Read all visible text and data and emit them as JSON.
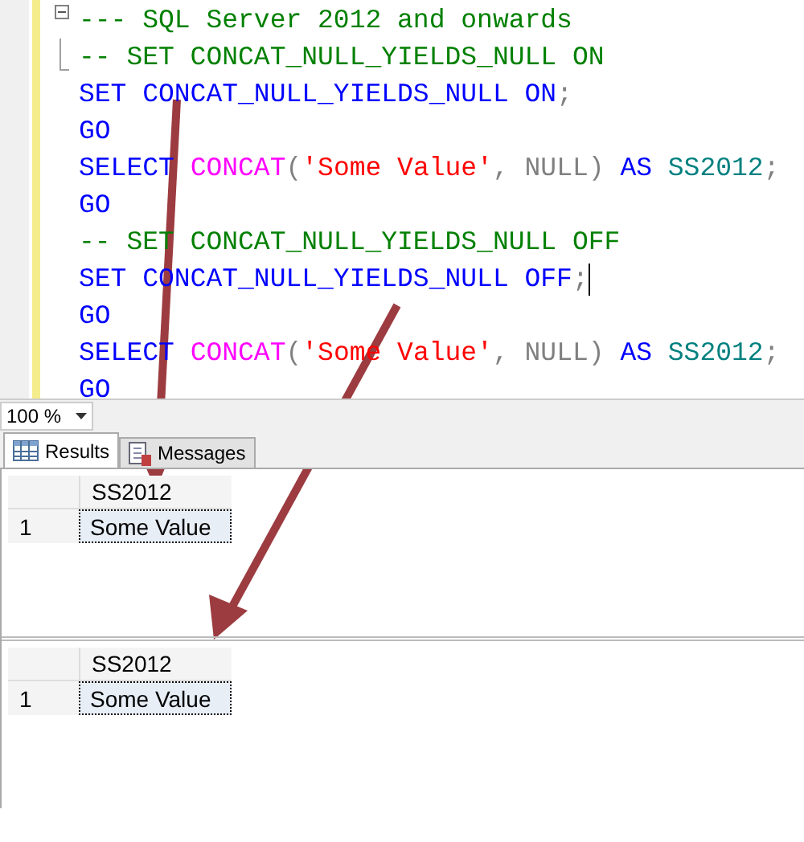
{
  "editor": {
    "lines": [
      {
        "tokens": [
          {
            "kind": "comment",
            "text": "--- SQL Server 2012 and onwards"
          }
        ]
      },
      {
        "tokens": [
          {
            "kind": "comment",
            "text": "-- SET CONCAT_NULL_YIELDS_NULL ON"
          }
        ]
      },
      {
        "tokens": [
          {
            "kind": "keyword",
            "text": "SET CONCAT_NULL_YIELDS_NULL ON"
          },
          {
            "kind": "punct",
            "text": ";"
          }
        ]
      },
      {
        "tokens": [
          {
            "kind": "keyword",
            "text": "GO"
          }
        ]
      },
      {
        "tokens": [
          {
            "kind": "keyword",
            "text": "SELECT "
          },
          {
            "kind": "function",
            "text": "CONCAT"
          },
          {
            "kind": "punct",
            "text": "("
          },
          {
            "kind": "string",
            "text": "'Some Value'"
          },
          {
            "kind": "punct",
            "text": ", NULL) "
          },
          {
            "kind": "keyword",
            "text": "AS "
          },
          {
            "kind": "identifier",
            "text": "SS2012"
          },
          {
            "kind": "punct",
            "text": ";"
          }
        ]
      },
      {
        "tokens": [
          {
            "kind": "keyword",
            "text": "GO"
          }
        ]
      },
      {
        "tokens": [
          {
            "kind": "comment",
            "text": "-- SET CONCAT_NULL_YIELDS_NULL OFF"
          }
        ]
      },
      {
        "cursor": true,
        "tokens": [
          {
            "kind": "keyword",
            "text": "SET CONCAT_NULL_YIELDS_NULL OFF"
          },
          {
            "kind": "punct",
            "text": ";"
          }
        ]
      },
      {
        "tokens": [
          {
            "kind": "keyword",
            "text": "GO"
          }
        ]
      },
      {
        "tokens": [
          {
            "kind": "keyword",
            "text": "SELECT "
          },
          {
            "kind": "function",
            "text": "CONCAT"
          },
          {
            "kind": "punct",
            "text": "("
          },
          {
            "kind": "string",
            "text": "'Some Value'"
          },
          {
            "kind": "punct",
            "text": ", NULL) "
          },
          {
            "kind": "keyword",
            "text": "AS "
          },
          {
            "kind": "identifier",
            "text": "SS2012"
          },
          {
            "kind": "punct",
            "text": ";"
          }
        ]
      },
      {
        "tokens": [
          {
            "kind": "keyword",
            "text": "GO"
          }
        ]
      }
    ]
  },
  "zoom": {
    "value": "100 %"
  },
  "tabs": [
    {
      "label": "Results",
      "selected": true
    },
    {
      "label": "Messages",
      "selected": false
    }
  ],
  "results": [
    {
      "columns": [
        "SS2012"
      ],
      "rows": [
        {
          "number": "1",
          "cells": [
            "Some Value"
          ]
        }
      ]
    },
    {
      "columns": [
        "SS2012"
      ],
      "rows": [
        {
          "number": "1",
          "cells": [
            "Some Value"
          ]
        }
      ]
    }
  ]
}
